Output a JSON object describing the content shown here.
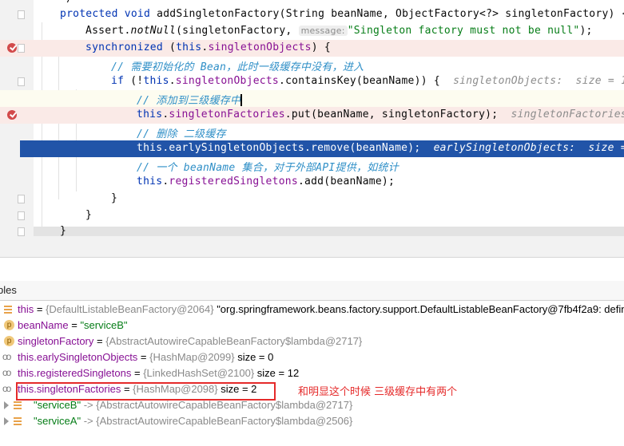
{
  "editor": {
    "lines": [
      {
        "tokens": [
          {
            "t": "*/",
            "c": ""
          }
        ]
      },
      {
        "tokens": [
          {
            "t": "protected void ",
            "c": "kw"
          },
          {
            "t": "addSingletonFactory(String beanName, ObjectFactory<?> singletonFactory) {",
            "c": ""
          }
        ]
      },
      {
        "tokens": [
          {
            "t": "Assert.",
            "c": ""
          },
          {
            "t": "notNull",
            "c": "it"
          },
          {
            "t": "(singletonFactory, ",
            "c": ""
          },
          {
            "t": "message:",
            "c": "param"
          },
          {
            "t": "\"Singleton factory must not be null\"",
            "c": "str"
          },
          {
            "t": ");",
            "c": ""
          }
        ]
      },
      {
        "tokens": [
          {
            "t": "synchronized ",
            "c": "kw"
          },
          {
            "t": "(",
            "c": ""
          },
          {
            "t": "this",
            "c": "kw"
          },
          {
            "t": ".",
            "c": ""
          },
          {
            "t": "singletonObjects",
            "c": "fld"
          },
          {
            "t": ") {",
            "c": ""
          }
        ]
      },
      {
        "tokens": [
          {
            "t": "// 需要初始化的 Bean，此时一级缓存中没有，进入",
            "c": "cm"
          }
        ]
      },
      {
        "tokens": [
          {
            "t": "if ",
            "c": "kw"
          },
          {
            "t": "(!",
            "c": ""
          },
          {
            "t": "this",
            "c": "kw"
          },
          {
            "t": ".",
            "c": ""
          },
          {
            "t": "singletonObjects",
            "c": "fld"
          },
          {
            "t": ".containsKey(beanName)) {  ",
            "c": ""
          },
          {
            "t": "singletonObjects:  size = 1",
            "c": "hint"
          }
        ]
      },
      {
        "tokens": [
          {
            "t": "// 添加到三级缓存中",
            "c": "cm"
          }
        ]
      },
      {
        "tokens": [
          {
            "t": "this",
            "c": "kw"
          },
          {
            "t": ".",
            "c": ""
          },
          {
            "t": "singletonFactories",
            "c": "fld"
          },
          {
            "t": ".put(beanName, singletonFactory);  ",
            "c": ""
          },
          {
            "t": "singletonFactories",
            "c": "hint"
          }
        ]
      },
      {
        "tokens": [
          {
            "t": "// 删除 二级缓存",
            "c": "cm"
          }
        ]
      },
      {
        "tokens": [
          {
            "t": "this",
            "c": "kw"
          },
          {
            "t": ".",
            "c": ""
          },
          {
            "t": "earlySingletonObjects",
            "c": "fld"
          },
          {
            "t": ".remove(beanName);  ",
            "c": ""
          },
          {
            "t": "earlySingletonObjects:  size = ",
            "c": "hint"
          }
        ]
      },
      {
        "tokens": [
          {
            "t": "// 一个 beanName 集合，对于外部API提供，如统计",
            "c": "cm"
          }
        ]
      },
      {
        "tokens": [
          {
            "t": "this",
            "c": "kw"
          },
          {
            "t": ".",
            "c": ""
          },
          {
            "t": "registeredSingletons",
            "c": "fld"
          },
          {
            "t": ".add(beanName);",
            "c": ""
          }
        ]
      },
      {
        "tokens": [
          {
            "t": "}",
            "c": ""
          }
        ]
      },
      {
        "tokens": [
          {
            "t": "}",
            "c": ""
          }
        ]
      },
      {
        "tokens": [
          {
            "t": "}",
            "c": ""
          }
        ]
      }
    ]
  },
  "panel": {
    "title": "bles"
  },
  "variables": [
    {
      "icon": "field-list-icon",
      "name": "this",
      "ref": "{DefaultListableBeanFactory@2064}",
      "extra": " \"org.springframework.beans.factory.support.DefaultListableBeanFactory@7fb4f2a9: defin"
    },
    {
      "icon": "parameter-icon",
      "name": "beanName",
      "str": "\"serviceB\""
    },
    {
      "icon": "parameter-icon",
      "name": "singletonFactory",
      "ref": "{AbstractAutowireCapableBeanFactory$lambda@2717}"
    },
    {
      "icon": "watch-icon",
      "name": "this.earlySingletonObjects",
      "ref": "{HashMap@2099}",
      "extra": "  size = 0"
    },
    {
      "icon": "watch-icon",
      "name": "this.registeredSingletons",
      "ref": "{LinkedHashSet@2100}",
      "extra": "  size = 12"
    },
    {
      "icon": "watch-icon",
      "name": "this.singletonFactories",
      "ref": "{HashMap@2098}",
      "extra": "  size = 2"
    },
    {
      "icon": "map-entry-icon",
      "key": "\"serviceB\"",
      "arrow": " -> ",
      "ref": "{AbstractAutowireCapableBeanFactory$lambda@2717}"
    },
    {
      "icon": "map-entry-icon",
      "key": "\"serviceA\"",
      "arrow": " -> ",
      "ref": "{AbstractAutowireCapableBeanFactory$lambda@2506}"
    }
  ],
  "annotation": {
    "text": "和明显这个时候 三级缓存中有两个",
    "color": "#e52a2a"
  }
}
